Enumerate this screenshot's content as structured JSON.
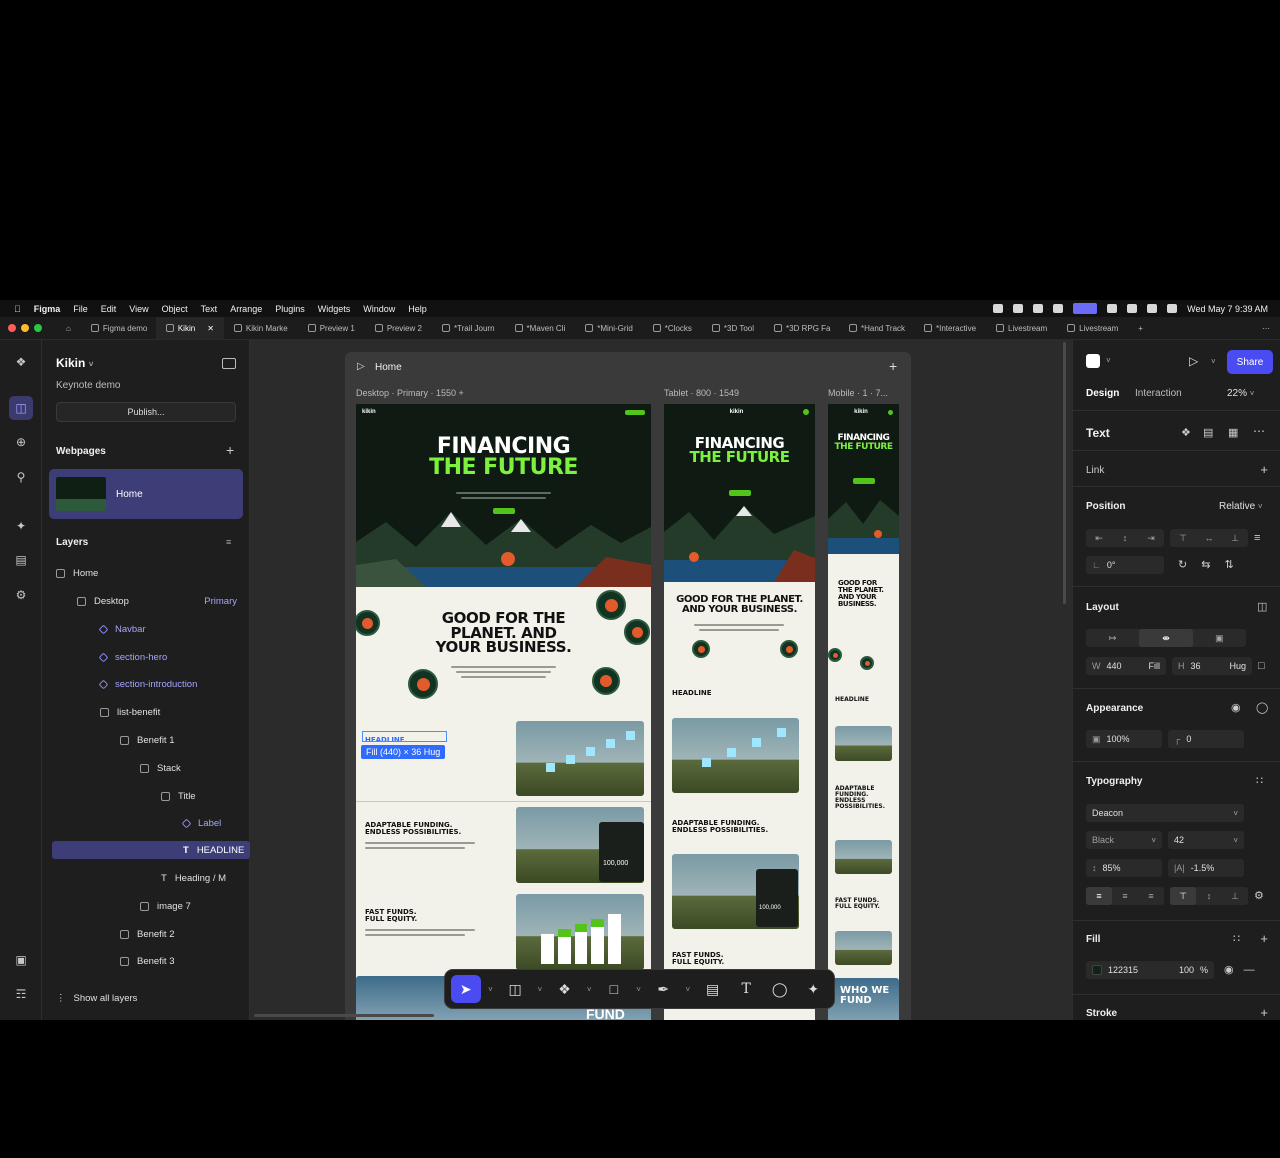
{
  "menubar": {
    "items": [
      "Figma",
      "File",
      "Edit",
      "View",
      "Object",
      "Text",
      "Arrange",
      "Plugins",
      "Widgets",
      "Window",
      "Help"
    ],
    "clock": "Wed May 7  9:39 AM"
  },
  "tabs": [
    {
      "label": "Figma demo"
    },
    {
      "label": "Kikin"
    },
    {
      "label": "Kikin Marke"
    },
    {
      "label": "Preview 1"
    },
    {
      "label": "Preview 2"
    },
    {
      "label": "*Trail Journ"
    },
    {
      "label": "*Maven Cli"
    },
    {
      "label": "*Mini-Grid"
    },
    {
      "label": "*Clocks"
    },
    {
      "label": "*3D Tool"
    },
    {
      "label": "*3D RPG Fa"
    },
    {
      "label": "*Hand Track"
    },
    {
      "label": "*Interactive"
    },
    {
      "label": "Livestream"
    },
    {
      "label": "Livestream"
    }
  ],
  "left_panel": {
    "project_title": "Kikin",
    "subtitle": "Keynote demo",
    "publish_label": "Publish...",
    "webpages_header": "Webpages",
    "webpage_item": "Home",
    "layers_header": "Layers",
    "layers": [
      {
        "label": "Home",
        "tag": ""
      },
      {
        "label": "Desktop",
        "tag": "Primary"
      },
      {
        "label": "Navbar",
        "tag": ""
      },
      {
        "label": "section-hero",
        "tag": ""
      },
      {
        "label": "section-introduction",
        "tag": ""
      },
      {
        "label": "list-benefit",
        "tag": ""
      },
      {
        "label": "Benefit 1",
        "tag": ""
      },
      {
        "label": "Stack",
        "tag": ""
      },
      {
        "label": "Title",
        "tag": ""
      },
      {
        "label": "Label",
        "tag": ""
      },
      {
        "label": "HEADLINE",
        "tag": ""
      },
      {
        "label": "Heading / M",
        "tag": ""
      },
      {
        "label": "image 7",
        "tag": ""
      },
      {
        "label": "Benefit 2",
        "tag": ""
      },
      {
        "label": "Benefit 3",
        "tag": ""
      }
    ],
    "show_all_layers": "Show all layers"
  },
  "canvas": {
    "frame_title": "Home",
    "desktop_label": "Desktop · Primary · 1550 +",
    "tablet_label": "Tablet · 800 · 1549",
    "mobile_label": "Mobile · 1 · 7...",
    "site": {
      "logo": "kikin",
      "hero_line1": "FINANCING",
      "hero_line2": "THE FUTURE",
      "good_line1": "GOOD FOR THE",
      "good_line2": "PLANET. AND",
      "good_line3": "YOUR BUSINESS.",
      "tablet_good_line1": "GOOD FOR THE PLANET.",
      "tablet_good_line2": "AND YOUR BUSINESS.",
      "mobile_good_line1": "GOOD FOR",
      "mobile_good_line2": "THE PLANET.",
      "mobile_good_line3": "AND YOUR",
      "mobile_good_line4": "BUSINESS.",
      "headline": "HEADLINE",
      "adaptable_line1": "ADAPTABLE FUNDING.",
      "adaptable_line2": "ENDLESS POSSIBILITIES.",
      "mobile_adaptable_line1": "ADAPTABLE",
      "mobile_adaptable_line2": "FUNDING.",
      "mobile_adaptable_line3": "ENDLESS",
      "mobile_adaptable_line4": "POSSIBILITIES.",
      "fast_line1": "FAST FUNDS.",
      "fast_line2": "FULL EQUITY.",
      "amount": "100,000",
      "fund": "FUND",
      "who_line1": "WHO WE",
      "who_line2": "FUND"
    },
    "selection_label": "Fill (440) × 36 Hug"
  },
  "right_panel": {
    "share_label": "Share",
    "tab_design": "Design",
    "tab_interaction": "Interaction",
    "zoom": "22%",
    "text_header": "Text",
    "link_header": "Link",
    "position_header": "Position",
    "position_value": "Relative",
    "rotation": "0°",
    "layout_header": "Layout",
    "width_label": "W",
    "width_value": "440",
    "width_mode": "Fill",
    "height_label": "H",
    "height_value": "36",
    "height_mode": "Hug",
    "appearance_header": "Appearance",
    "opacity": "100%",
    "radius": "0",
    "typography_header": "Typography",
    "font_family": "Deacon",
    "font_weight": "Black",
    "font_size": "42",
    "line_height": "85%",
    "letter_spacing": "-1.5%",
    "fill_header": "Fill",
    "fill_hex": "122315",
    "fill_opacity": "100",
    "fill_percent": "%",
    "stroke_header": "Stroke"
  },
  "colors": {
    "accent": "#4b4bf2",
    "selection": "#2f6bff",
    "brand_green": "#7cf23f",
    "hero_dark": "#0f1a12"
  }
}
